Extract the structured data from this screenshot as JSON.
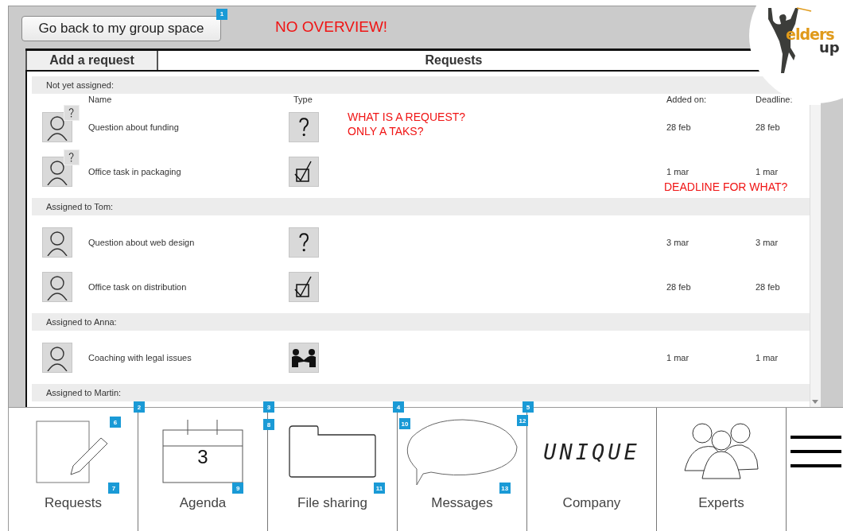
{
  "header": {
    "back_button": "Go back to my group space",
    "back_badge": "1",
    "note": "NO OVERVIEW!"
  },
  "logo": {
    "word": "elders",
    "suffix": "up"
  },
  "panel": {
    "add_button": "Add a request",
    "title": "Requests"
  },
  "groups": [
    {
      "title": "Not yet assigned:",
      "columns": [
        "Name",
        "Type",
        "Added on:",
        "Deadline:"
      ],
      "requests": [
        {
          "name": "Question about funding",
          "kind": "question",
          "pending": true,
          "added": "28 feb",
          "deadline": "28 feb",
          "note": {
            "text": "WHAT IS A REQUEST?\nONLY A TAKS?",
            "kind": "beside"
          }
        },
        {
          "name": "Office task in packaging",
          "kind": "task",
          "pending": true,
          "added": "1 mar",
          "deadline": "1 mar",
          "note": {
            "text": "DEADLINE FOR WHAT?",
            "kind": "below"
          }
        }
      ]
    },
    {
      "title": "Assigned to Tom:",
      "requests": [
        {
          "name": "Question about web design",
          "kind": "question",
          "pending": false,
          "added": "3 mar",
          "deadline": "3 mar"
        },
        {
          "name": "Office task on distribution",
          "kind": "task",
          "pending": false,
          "added": "28 feb",
          "deadline": "28 feb"
        }
      ]
    },
    {
      "title": "Assigned to Anna:",
      "requests": [
        {
          "name": "Coaching with legal issues",
          "kind": "coaching",
          "pending": false,
          "added": "1 mar",
          "deadline": "1 mar"
        }
      ]
    },
    {
      "title": "Assigned to Martin:"
    }
  ],
  "nav": [
    {
      "kind": "requests",
      "label": "Requests",
      "badges": [
        {
          "label": "2",
          "kind": "edge"
        },
        {
          "label": "6",
          "kind": "icon-corner"
        },
        {
          "label": "7",
          "kind": "label"
        }
      ]
    },
    {
      "kind": "agenda",
      "label": "Agenda",
      "day": "3",
      "badges": [
        {
          "label": "3",
          "kind": "edge"
        },
        {
          "label": "8",
          "kind": "edge-lower"
        },
        {
          "label": "9",
          "kind": "label"
        }
      ]
    },
    {
      "kind": "files",
      "label": "File sharing",
      "badges": [
        {
          "label": "4",
          "kind": "edge"
        },
        {
          "label": "11",
          "kind": "label"
        }
      ]
    },
    {
      "kind": "messages",
      "label": "Messages",
      "badges": [
        {
          "label": "5",
          "kind": "edge"
        },
        {
          "label": "10",
          "kind": "icon-left"
        },
        {
          "label": "12",
          "kind": "icon-corner"
        },
        {
          "label": "13",
          "kind": "label"
        }
      ]
    },
    {
      "kind": "company",
      "label": "Company",
      "logo_text": "UNIQUE"
    },
    {
      "kind": "experts",
      "label": "Experts"
    },
    {
      "kind": "menu"
    }
  ]
}
